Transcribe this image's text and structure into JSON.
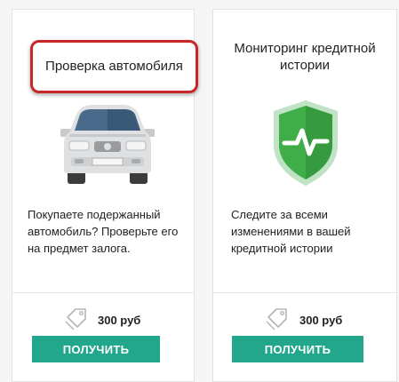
{
  "products": [
    {
      "title": "Проверка автомобиля",
      "description": "Покупаете подержанный автомобиль? Проверьте его на предмет залога.",
      "price": "300 руб",
      "button_label": "ПОЛУЧИТЬ",
      "icon": "car-icon",
      "highlighted": true
    },
    {
      "title": "Мониторинг кредитной истории",
      "description": "Следите за всеми изменениями в вашей кредитной истории",
      "price": "300 руб",
      "button_label": "ПОЛУЧИТЬ",
      "icon": "shield-check-icon",
      "highlighted": false
    }
  ],
  "colors": {
    "button": "#22a68c",
    "highlight_border": "#c62828",
    "shield_green": "#3fae49",
    "car_gray": "#dfe0e2",
    "car_windshield": "#4a6a8c"
  }
}
